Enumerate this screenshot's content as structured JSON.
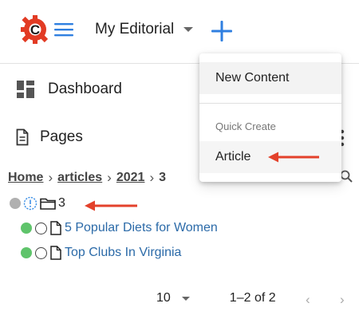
{
  "header": {
    "site_name": "My Editorial",
    "icons": [
      "crafter-logo-icon",
      "hamburger-menu-icon",
      "chevron-down-icon",
      "plus-icon"
    ],
    "accent_color": "#2f7fe0",
    "logo_color": "#e23b24"
  },
  "sidebar": {
    "items": [
      {
        "label": "Dashboard",
        "icon": "dashboard-grid-icon"
      },
      {
        "label": "Pages",
        "icon": "document-icon"
      }
    ]
  },
  "breadcrumb": {
    "items": [
      "Home",
      "articles",
      "2021",
      "3"
    ],
    "separator": "›"
  },
  "tree": {
    "root": {
      "label": "3",
      "status_color": "#b0b0b0"
    },
    "children": [
      {
        "label": "5 Popular Diets for Women",
        "status_color": "#5fc46b"
      },
      {
        "label": "Top Clubs In Virginia",
        "status_color": "#5fc46b"
      }
    ],
    "link_color": "#2b6aa8"
  },
  "pagination": {
    "page_size": "10",
    "range": "1–2 of 2",
    "prev_glyph": "‹",
    "next_glyph": "›"
  },
  "create_menu": {
    "new_content_label": "New Content",
    "quick_create_label": "Quick Create",
    "items": [
      "Article"
    ]
  },
  "annotation": {
    "arrow_color": "#e3412b"
  }
}
